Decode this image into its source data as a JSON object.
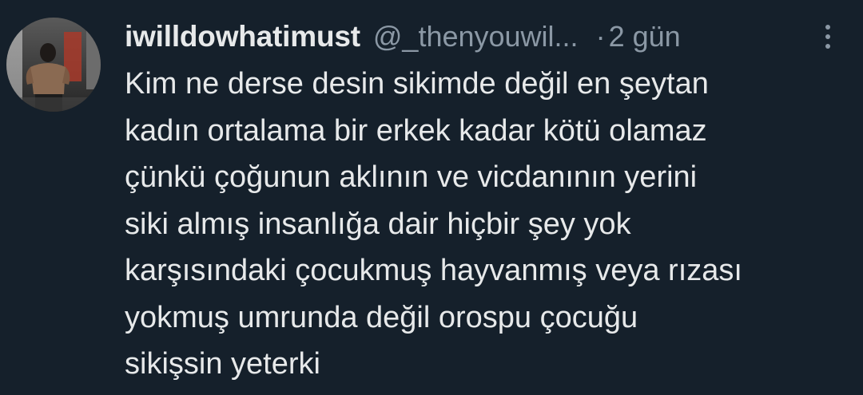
{
  "tweet": {
    "display_name": "iwilldowhatimust",
    "handle": "@_thenyouwil...",
    "separator": "·",
    "timestamp": "2 gün",
    "more_icon": "more-vertical-icon",
    "avatar_icon": "profile-photo",
    "text_lines": [
      "Kim ne derse desin sikimde değil en şeytan",
      "kadın ortalama bir erkek kadar kötü olamaz",
      "çünkü çoğunun aklının ve vicdanının yerini",
      "siki almış insanlığa dair hiçbir şey yok",
      "karşısındaki çocukmuş hayvanmış veya rızası",
      "yokmuş umrunda değil orospu çocuğu",
      "sikişsin yeterki"
    ]
  },
  "colors": {
    "background": "#15202b",
    "primary_text": "#e7e9ea",
    "secondary_text": "#8b98a5"
  }
}
